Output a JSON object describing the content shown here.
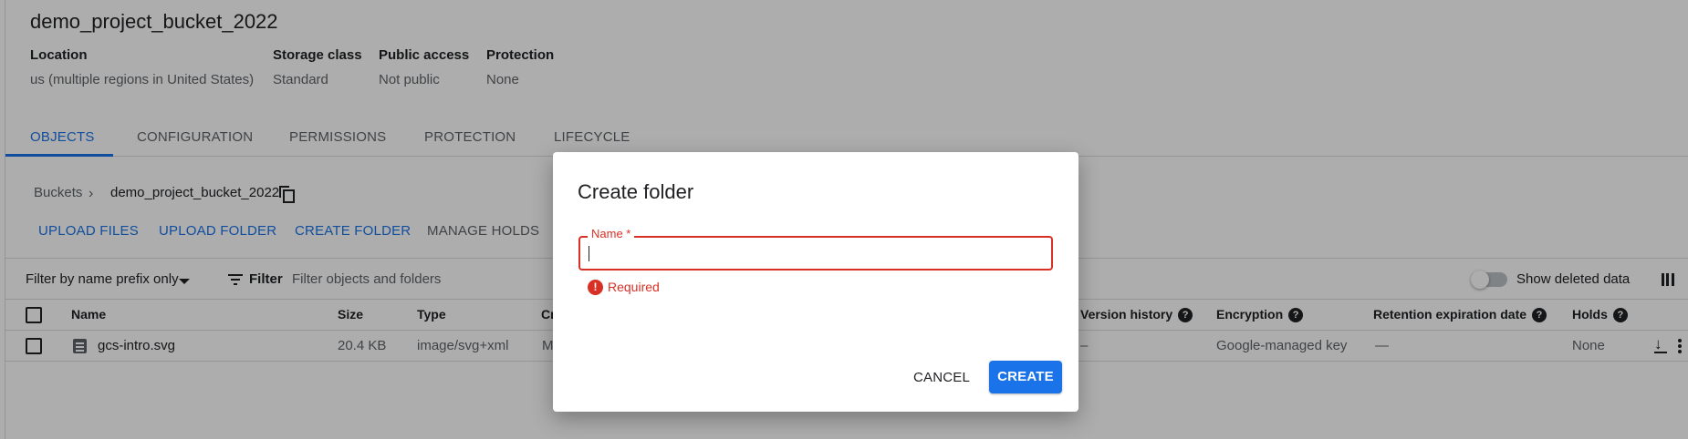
{
  "bucket": {
    "title": "demo_project_bucket_2022",
    "meta": [
      {
        "label": "Location",
        "value": "us (multiple regions in United States)"
      },
      {
        "label": "Storage class",
        "value": "Standard"
      },
      {
        "label": "Public access",
        "value": "Not public"
      },
      {
        "label": "Protection",
        "value": "None"
      }
    ]
  },
  "tabs": [
    "OBJECTS",
    "CONFIGURATION",
    "PERMISSIONS",
    "PROTECTION",
    "LIFECYCLE"
  ],
  "active_tab": "OBJECTS",
  "breadcrumb": {
    "root": "Buckets",
    "current": "demo_project_bucket_2022"
  },
  "actions": [
    "UPLOAD FILES",
    "UPLOAD FOLDER",
    "CREATE FOLDER",
    "MANAGE HOLDS"
  ],
  "filter": {
    "mode": "Filter by name prefix only",
    "label": "Filter",
    "placeholder": "Filter objects and folders",
    "show_deleted_label": "Show deleted data"
  },
  "table": {
    "headers": [
      "Name",
      "Size",
      "Type",
      "Cr",
      "Version history",
      "Encryption",
      "Retention expiration date",
      "Holds"
    ],
    "rows": [
      {
        "name": "gcs-intro.svg",
        "size": "20.4 KB",
        "type": "image/svg+xml",
        "created": "M",
        "version": "–",
        "encryption": "Google-managed key",
        "retention": "—",
        "holds": "None"
      }
    ]
  },
  "dialog": {
    "title": "Create folder",
    "field_label": "Name *",
    "field_value": "",
    "error": "Required",
    "cancel": "CANCEL",
    "create": "CREATE"
  },
  "colors": {
    "accent": "#1a73e8",
    "error": "#d93025",
    "text": "#202124",
    "muted": "#5f6368"
  }
}
